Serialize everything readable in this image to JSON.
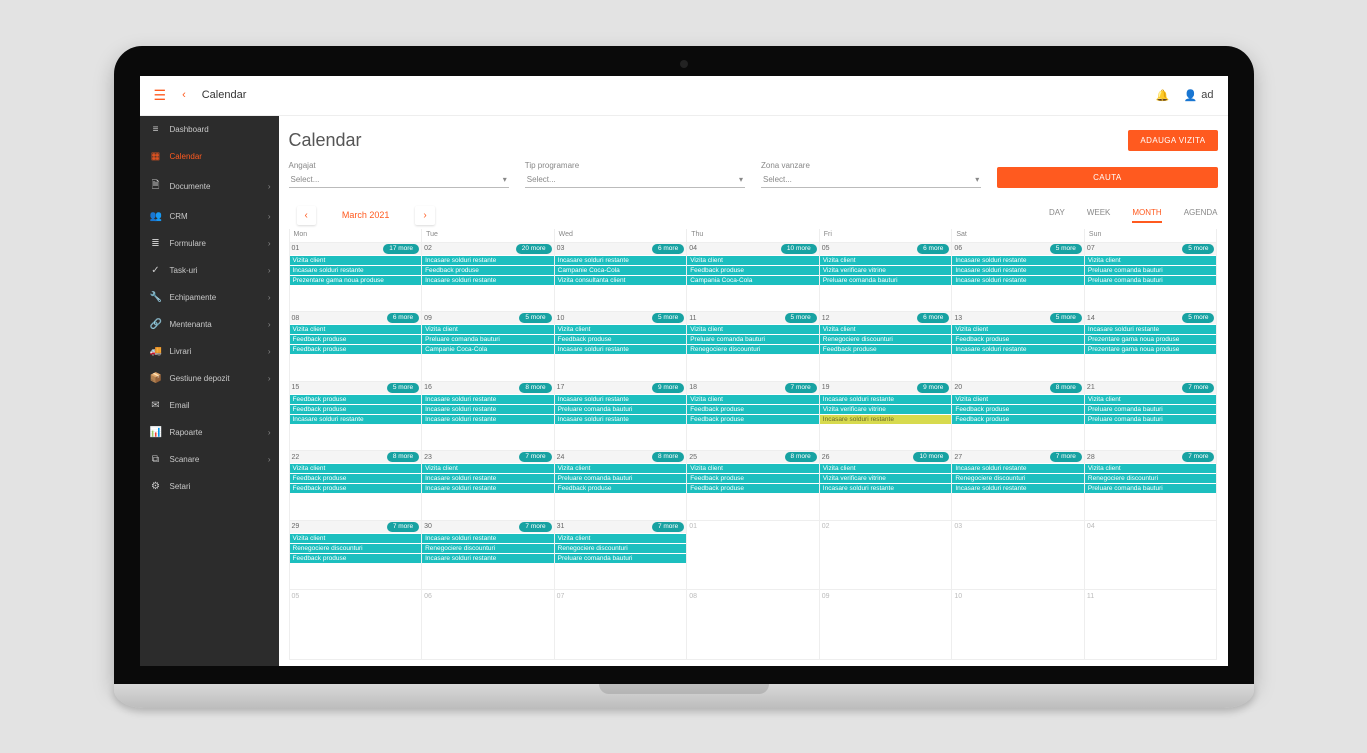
{
  "header": {
    "title": "Calendar",
    "user_name": "ad"
  },
  "sidebar": {
    "items": [
      {
        "icon": "bars-icon",
        "label": "Dashboard",
        "expand": false
      },
      {
        "icon": "calendar-icon",
        "label": "Calendar",
        "expand": false,
        "active": true
      },
      {
        "icon": "document-icon",
        "label": "Documente",
        "expand": true
      },
      {
        "icon": "people-icon",
        "label": "CRM",
        "expand": true
      },
      {
        "icon": "list-icon",
        "label": "Formulare",
        "expand": true
      },
      {
        "icon": "check-icon",
        "label": "Task-uri",
        "expand": true
      },
      {
        "icon": "wrench-icon",
        "label": "Echipamente",
        "expand": true
      },
      {
        "icon": "link-icon",
        "label": "Mentenanta",
        "expand": true
      },
      {
        "icon": "truck-icon",
        "label": "Livrari",
        "expand": true
      },
      {
        "icon": "box-icon",
        "label": "Gestiune depozit",
        "expand": true
      },
      {
        "icon": "mail-icon",
        "label": "Email",
        "expand": false
      },
      {
        "icon": "chart-icon",
        "label": "Rapoarte",
        "expand": true
      },
      {
        "icon": "scan-icon",
        "label": "Scanare",
        "expand": true
      },
      {
        "icon": "gear-icon",
        "label": "Setari",
        "expand": false
      }
    ]
  },
  "main": {
    "title": "Calendar",
    "add_button": "ADAUGA VIZITA",
    "filters": {
      "angajat": {
        "label": "Angajat",
        "placeholder": "Select..."
      },
      "tip": {
        "label": "Tip programare",
        "placeholder": "Select..."
      },
      "zona": {
        "label": "Zona vanzare",
        "placeholder": "Select..."
      }
    },
    "search_button": "CAUTA",
    "toolbar": {
      "period": "March 2021",
      "views": {
        "day": "DAY",
        "week": "WEEK",
        "month": "MONTH",
        "agenda": "AGENDA",
        "active": "month"
      }
    },
    "day_headers": [
      "Mon",
      "Tue",
      "Wed",
      "Thu",
      "Fri",
      "Sat",
      "Sun"
    ],
    "more_suffix": " more",
    "weeks": [
      [
        {
          "d": "01",
          "more": 17,
          "ev": [
            "Vizita client",
            "Incasare solduri restante",
            "Prezentare gama noua produse"
          ]
        },
        {
          "d": "02",
          "more": 20,
          "ev": [
            "Incasare solduri restante",
            "Feedback produse",
            "Incasare solduri restante"
          ]
        },
        {
          "d": "03",
          "more": 6,
          "ev": [
            "Incasare solduri restante",
            "Campanie Coca-Cola",
            "Vizita consultanta client"
          ]
        },
        {
          "d": "04",
          "more": 10,
          "ev": [
            "Vizita client",
            "Feedback produse",
            "Campania Coca-Cola"
          ]
        },
        {
          "d": "05",
          "more": 6,
          "ev": [
            "Vizita client",
            "Vizita verificare vitrine",
            "Preluare comanda bauturi"
          ]
        },
        {
          "d": "06",
          "more": 5,
          "ev": [
            "Incasare solduri restante",
            "Incasare solduri restante",
            "Incasare solduri restante"
          ]
        },
        {
          "d": "07",
          "more": 5,
          "ev": [
            "Vizita client",
            "Preluare comanda bauturi",
            "Preluare comanda bauturi"
          ]
        }
      ],
      [
        {
          "d": "08",
          "more": 6,
          "ev": [
            "Vizita client",
            "Feedback produse",
            "Feedback produse"
          ]
        },
        {
          "d": "09",
          "more": 5,
          "ev": [
            "Vizita client",
            "Preluare comanda bauturi",
            "Campanie Coca-Cola"
          ]
        },
        {
          "d": "10",
          "more": 5,
          "ev": [
            "Vizita client",
            "Feedback produse",
            "Incasare solduri restante"
          ]
        },
        {
          "d": "11",
          "more": 5,
          "ev": [
            "Vizita client",
            "Preluare comanda bauturi",
            "Renegociere discounturi"
          ]
        },
        {
          "d": "12",
          "more": 6,
          "ev": [
            "Vizita client",
            "Renegociere discounturi",
            "Feedback produse"
          ]
        },
        {
          "d": "13",
          "more": 5,
          "ev": [
            "Vizita client",
            "Feedback produse",
            "Incasare solduri restante"
          ]
        },
        {
          "d": "14",
          "more": 5,
          "ev": [
            "Incasare solduri restante",
            "Prezentare gama noua produse",
            "Prezentare gama noua produse"
          ]
        }
      ],
      [
        {
          "d": "15",
          "more": 5,
          "ev": [
            "Feedback produse",
            "Feedback produse",
            "Incasare solduri restante"
          ]
        },
        {
          "d": "16",
          "more": 8,
          "ev": [
            "Incasare solduri restante",
            "Incasare solduri restante",
            "Incasare solduri restante"
          ]
        },
        {
          "d": "17",
          "more": 9,
          "ev": [
            "Incasare solduri restante",
            "Preluare comanda bauturi",
            "Incasare solduri restante"
          ]
        },
        {
          "d": "18",
          "more": 7,
          "ev": [
            "Vizita client",
            "Feedback produse",
            "Feedback produse"
          ]
        },
        {
          "d": "19",
          "more": 9,
          "ev": [
            "Incasare solduri restante",
            "Vizita verificare vitrine",
            {
              "t": "Incasare solduri restante",
              "hl": true
            }
          ]
        },
        {
          "d": "20",
          "more": 8,
          "ev": [
            "Vizita client",
            "Feedback produse",
            "Feedback produse"
          ]
        },
        {
          "d": "21",
          "more": 7,
          "ev": [
            "Vizita client",
            "Preluare comanda bauturi",
            "Preluare comanda bauturi"
          ]
        }
      ],
      [
        {
          "d": "22",
          "more": 8,
          "ev": [
            "Vizita client",
            "Feedback produse",
            "Feedback produse"
          ]
        },
        {
          "d": "23",
          "more": 7,
          "ev": [
            "Vizita client",
            "Incasare solduri restante",
            "Incasare solduri restante"
          ]
        },
        {
          "d": "24",
          "more": 8,
          "ev": [
            "Vizita client",
            "Preluare comanda bauturi",
            "Feedback produse"
          ]
        },
        {
          "d": "25",
          "more": 8,
          "ev": [
            "Vizita client",
            "Feedback produse",
            "Feedback produse"
          ]
        },
        {
          "d": "26",
          "more": 10,
          "ev": [
            "Vizita client",
            "Vizita verificare vitrine",
            "Incasare solduri restante"
          ]
        },
        {
          "d": "27",
          "more": 7,
          "ev": [
            "Incasare solduri restante",
            "Renegociere discounturi",
            "Incasare solduri restante"
          ]
        },
        {
          "d": "28",
          "more": 7,
          "ev": [
            "Vizita client",
            "Renegociere discounturi",
            "Preluare comanda bauturi"
          ]
        }
      ],
      [
        {
          "d": "29",
          "more": 7,
          "ev": [
            "Vizita client",
            "Renegociere discounturi",
            "Feedback produse"
          ]
        },
        {
          "d": "30",
          "more": 7,
          "ev": [
            "Incasare solduri restante",
            "Renegociere discounturi",
            "Incasare solduri restante"
          ]
        },
        {
          "d": "31",
          "more": 7,
          "ev": [
            "Vizita client",
            "Renegociere discounturi",
            "Preluare comanda bauturi"
          ]
        },
        {
          "d": "01",
          "other": true
        },
        {
          "d": "02",
          "other": true
        },
        {
          "d": "03",
          "other": true
        },
        {
          "d": "04",
          "other": true
        }
      ],
      [
        {
          "d": "05",
          "other": true
        },
        {
          "d": "06",
          "other": true
        },
        {
          "d": "07",
          "other": true
        },
        {
          "d": "08",
          "other": true
        },
        {
          "d": "09",
          "other": true
        },
        {
          "d": "10",
          "other": true
        },
        {
          "d": "11",
          "other": true
        }
      ]
    ]
  },
  "icons": {
    "bars-icon": "≡",
    "calendar-icon": "▦",
    "document-icon": "🗎",
    "people-icon": "👥",
    "list-icon": "≣",
    "check-icon": "✓",
    "wrench-icon": "🔧",
    "link-icon": "🔗",
    "truck-icon": "🚚",
    "box-icon": "📦",
    "mail-icon": "✉",
    "chart-icon": "📊",
    "scan-icon": "⧉",
    "gear-icon": "⚙",
    "bell-icon": "🔔",
    "user-icon": "👤",
    "menu-icon": "☰",
    "back-icon": "‹",
    "chevron-left-icon": "‹",
    "chevron-right-icon": "›",
    "caret-down-icon": "▾",
    "chevron-right-small": "›"
  }
}
